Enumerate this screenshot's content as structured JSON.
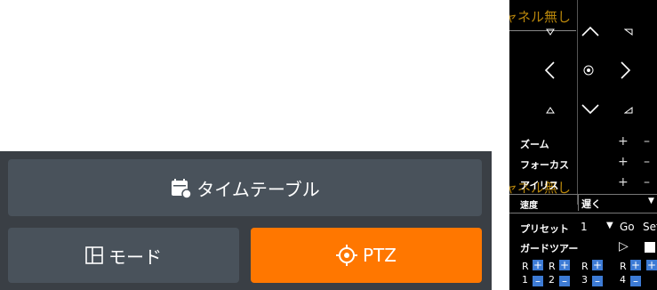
{
  "buttons": {
    "timetable": "タイムテーブル",
    "mode": "モード",
    "ptz": "PTZ"
  },
  "ptz": {
    "no_channel_top": "ャネル無し",
    "no_channel_mid": "ャネル無し",
    "zoom_label": "ズーム",
    "focus_label": "フォーカス",
    "iris_label": "アイリス",
    "speed_label": "速度",
    "speed_value": "遅く",
    "preset_label": "プリセット",
    "preset_value": "1",
    "go_label": "Go",
    "set_label": "Set",
    "guard_tour_label": "ガードツアー",
    "plus": "+",
    "minus": "–",
    "tours": [
      {
        "r": "R",
        "n": "1"
      },
      {
        "r": "R",
        "n": "2"
      },
      {
        "r": "R",
        "n": "3"
      },
      {
        "r": "R",
        "n": "4"
      }
    ]
  },
  "colors": {
    "accent": "#ff7700",
    "button_bg": "#49525b",
    "panel_bg": "#3a3f45",
    "ptz_bg": "#000000"
  }
}
